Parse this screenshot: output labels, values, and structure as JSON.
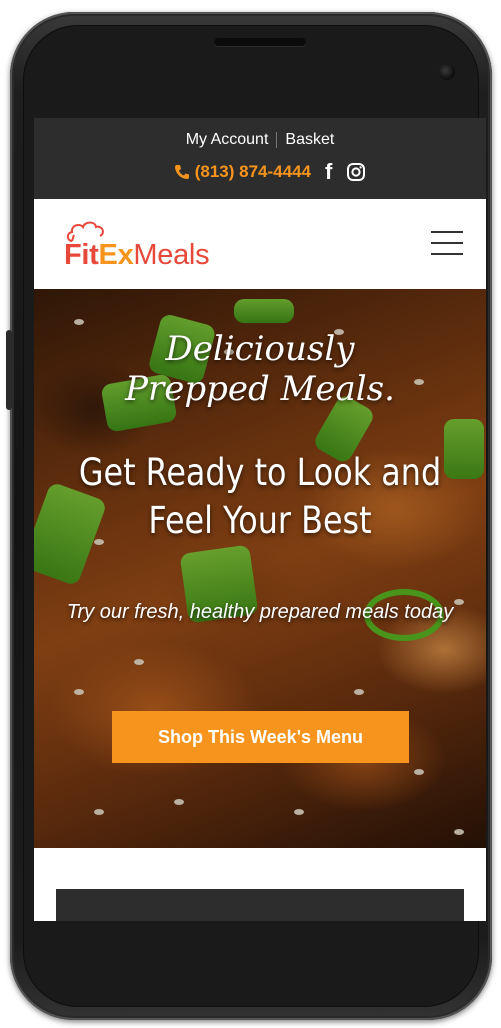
{
  "topbar": {
    "account_label": "My Account",
    "basket_label": "Basket",
    "phone": "(813) 874-4444",
    "phone_icon": "phone-icon",
    "facebook_glyph": "f",
    "social_icons": [
      "facebook-icon",
      "instagram-icon"
    ]
  },
  "header": {
    "logo": {
      "fit": "Fit",
      "ex": "Ex",
      "meals": "Meals"
    },
    "menu_icon": "hamburger-menu-icon"
  },
  "hero": {
    "script_line": "Deliciously Prepped Meals.",
    "title": "Get Ready to Look and Feel Your Best",
    "subtitle": "Try our fresh, healthy prepared meals today",
    "cta_label": "Shop This Week's Menu"
  },
  "colors": {
    "accent": "#f7941d",
    "brand_red": "#e8483a",
    "topbar_bg": "#2d2d2d"
  }
}
